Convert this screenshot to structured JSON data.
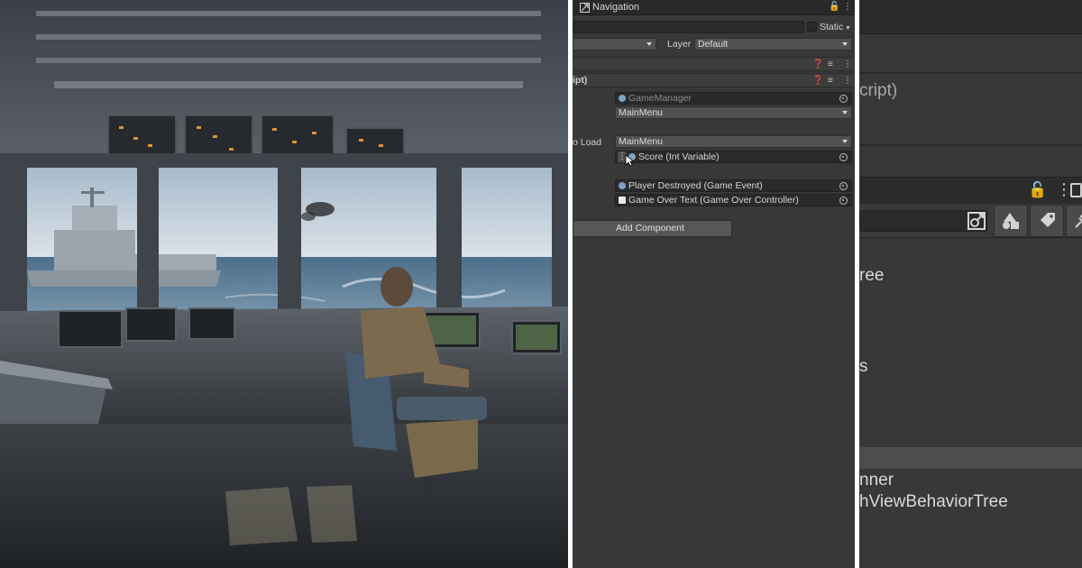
{
  "inspector": {
    "tab_title": "Navigation",
    "static_label": "Static",
    "layer_label": "Layer",
    "layer_value": "Default",
    "script_header_fragment": "ipt)",
    "script_field_value": "GameManager",
    "scene_dropdown_value": "MainMenu",
    "to_load_label_fragment": "o Load",
    "to_load_value": "MainMenu",
    "score_field": "Score (Int Variable)",
    "player_destroyed_field": "Player Destroyed (Game Event)",
    "game_over_field": "Game Over Text (Game Over Controller)",
    "add_component_label": "Add Component"
  },
  "zoom_panel": {
    "script_fragment": "cript)",
    "tree_fragment": "ree",
    "s_fragment": "s",
    "runner_fragment": "nner",
    "behavior_tree_fragment": "hViewBehaviorTree"
  },
  "colors": {
    "panel_bg": "#383838",
    "tab_bg": "#282828",
    "field_bg": "#2a2a2a",
    "dropdown_bg": "#515151"
  }
}
